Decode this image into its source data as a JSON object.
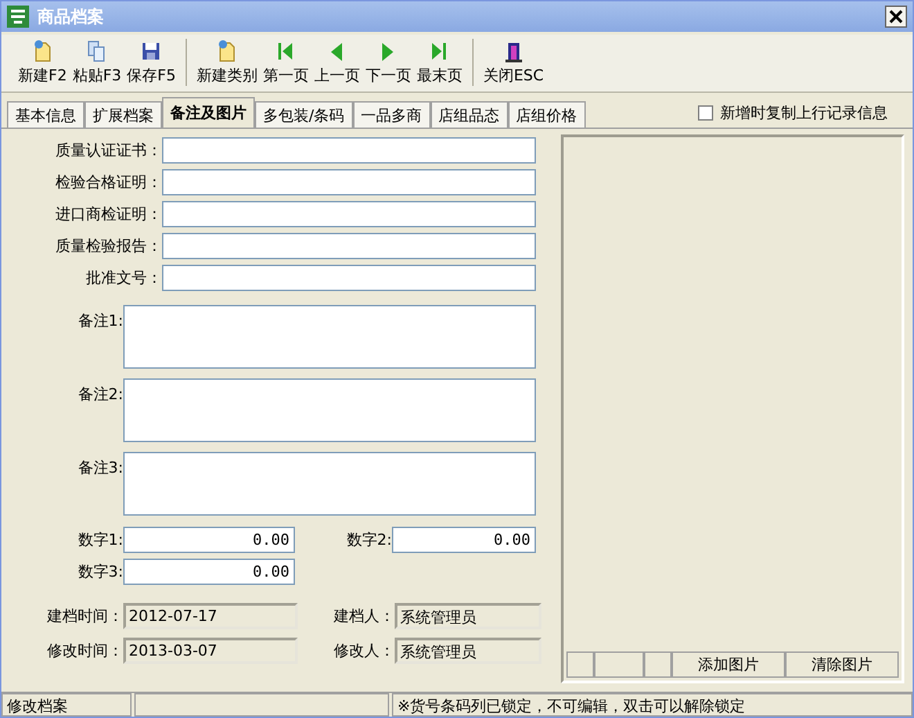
{
  "window": {
    "title": "商品档案"
  },
  "toolbar": [
    {
      "kind": "new",
      "label": "新建F2"
    },
    {
      "kind": "paste",
      "label": "粘贴F3"
    },
    {
      "kind": "save",
      "label": "保存F5"
    },
    {
      "kind": "separator"
    },
    {
      "kind": "new",
      "label": "新建类别"
    },
    {
      "kind": "first",
      "label": "第一页"
    },
    {
      "kind": "prev",
      "label": "上一页"
    },
    {
      "kind": "next",
      "label": "下一页"
    },
    {
      "kind": "last",
      "label": "最末页"
    },
    {
      "kind": "separator"
    },
    {
      "kind": "close",
      "label": "关闭ESC"
    }
  ],
  "tabs": [
    {
      "label": "基本信息",
      "selected": false
    },
    {
      "label": "扩展档案",
      "selected": false
    },
    {
      "label": "备注及图片",
      "selected": true
    },
    {
      "label": "多包装/条码",
      "selected": false
    },
    {
      "label": "一品多商",
      "selected": false
    },
    {
      "label": "店组品态",
      "selected": false
    },
    {
      "label": "店组价格",
      "selected": false
    }
  ],
  "copy_option": {
    "label": "新增时复制上行记录信息",
    "checked": false
  },
  "fields": [
    {
      "label": "质量认证证书："
    },
    {
      "label": "检验合格证明："
    },
    {
      "label": "进口商检证明："
    },
    {
      "label": "质量检验报告："
    },
    {
      "label": "批准文号："
    }
  ],
  "remarks": [
    {
      "label": "备注1:"
    },
    {
      "label": "备注2:"
    },
    {
      "label": "备注3:"
    }
  ],
  "numbers": [
    {
      "label": "数字1:",
      "value": "0.00"
    },
    {
      "label": "数字2:",
      "value": "0.00"
    },
    {
      "label": "数字3:",
      "value": "0.00"
    }
  ],
  "audit": [
    {
      "label": "建档时间：",
      "value": "2012-07-17"
    },
    {
      "label": "建档人：",
      "value": "系统管理员"
    },
    {
      "label": "修改时间：",
      "value": "2013-03-07"
    },
    {
      "label": "修改人：",
      "value": "系统管理员"
    }
  ],
  "picture_buttons": [
    "添加图片",
    "清除图片"
  ],
  "status_bar": {
    "mode": "修改档案",
    "message": "※货号条码列已锁定，不可编辑，双击可以解除锁定"
  }
}
